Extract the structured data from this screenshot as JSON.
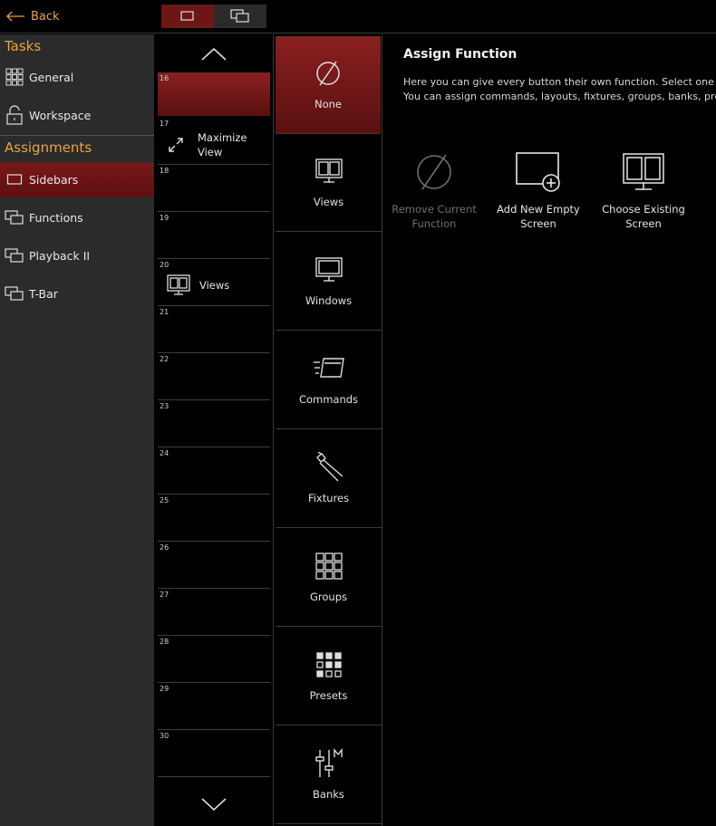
{
  "topbar": {
    "back_label": "Back"
  },
  "sidebar": {
    "tasks_title": "Tasks",
    "tasks": [
      {
        "label": "General"
      },
      {
        "label": "Workspace"
      }
    ],
    "assignments_title": "Assignments",
    "assignments": [
      {
        "label": "Sidebars",
        "selected": true
      },
      {
        "label": "Functions"
      },
      {
        "label": "Playback II"
      },
      {
        "label": "T-Bar"
      }
    ]
  },
  "buttons": [
    {
      "num": "16",
      "label": "",
      "selected": true
    },
    {
      "num": "17",
      "label": "Maximize View",
      "label_line1": "Maximize",
      "label_line2": "View",
      "icon": "maximize-icon"
    },
    {
      "num": "18",
      "label": ""
    },
    {
      "num": "19",
      "label": ""
    },
    {
      "num": "20",
      "label": "Views",
      "icon": "views-icon"
    },
    {
      "num": "21",
      "label": ""
    },
    {
      "num": "22",
      "label": ""
    },
    {
      "num": "23",
      "label": ""
    },
    {
      "num": "24",
      "label": ""
    },
    {
      "num": "25",
      "label": ""
    },
    {
      "num": "26",
      "label": ""
    },
    {
      "num": "27",
      "label": ""
    },
    {
      "num": "28",
      "label": ""
    },
    {
      "num": "29",
      "label": ""
    },
    {
      "num": "30",
      "label": ""
    }
  ],
  "categories": [
    {
      "label": "None",
      "icon": "none-icon",
      "selected": true
    },
    {
      "label": "Views",
      "icon": "views-icon"
    },
    {
      "label": "Windows",
      "icon": "windows-icon"
    },
    {
      "label": "Commands",
      "icon": "commands-icon"
    },
    {
      "label": "Fixtures",
      "icon": "fixtures-icon"
    },
    {
      "label": "Groups",
      "icon": "groups-icon"
    },
    {
      "label": "Presets",
      "icon": "presets-icon"
    },
    {
      "label": "Banks",
      "icon": "banks-icon"
    }
  ],
  "main": {
    "title": "Assign Function",
    "description_line1": "Here you can give every button their own function. Select one of",
    "description_line2": "You can assign commands, layouts, fixtures, groups, banks, preset",
    "options": [
      {
        "line1": "Remove Current",
        "line2": "Function",
        "enabled": false,
        "icon": "remove-function-icon"
      },
      {
        "line1": "Add New Empty",
        "line2": "Screen",
        "enabled": true,
        "icon": "add-screen-icon"
      },
      {
        "line1": "Choose Existing",
        "line2": "Screen",
        "enabled": true,
        "icon": "choose-screen-icon"
      }
    ]
  },
  "colors": {
    "accent": "#e9a43a",
    "selected": "#7a1818",
    "sidebar_bg": "#2b2b2b",
    "background": "#000000"
  }
}
